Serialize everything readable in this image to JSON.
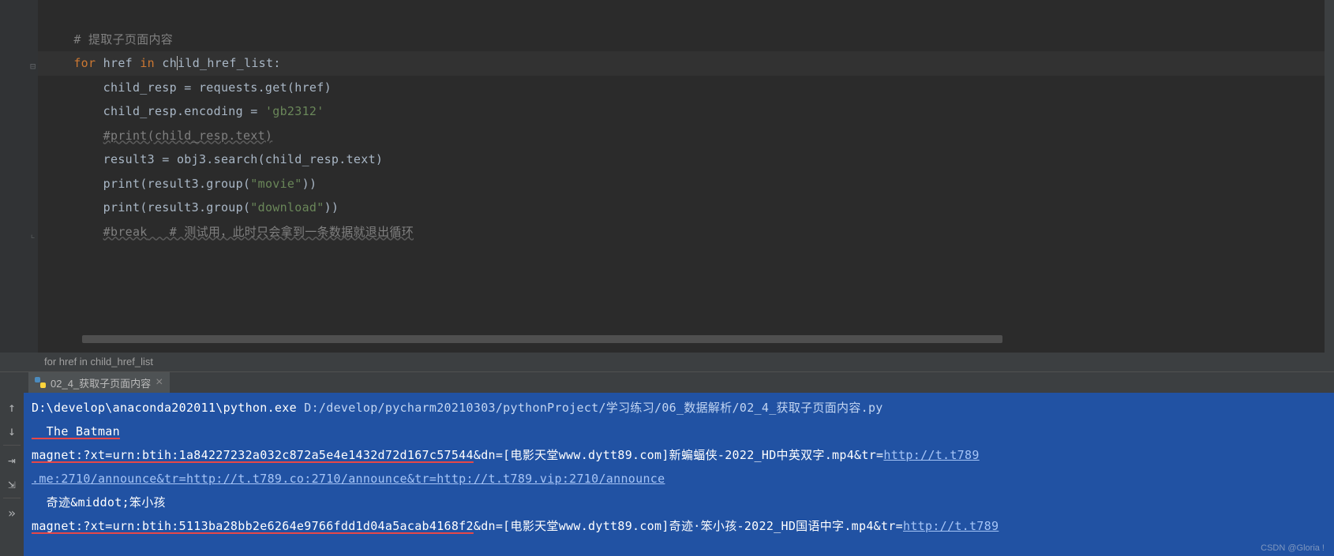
{
  "code": {
    "comment1": "# 提取子页面内容",
    "kw_for": "for",
    "var_href": "href",
    "kw_in": "in",
    "var_child_href_list": "child_href_list",
    "colon": ":",
    "line3_a": "child_resp = requests.get(href)",
    "line4_a": "child_resp.encoding = ",
    "line4_str": "'gb2312'",
    "line5": "#print(child_resp.text)",
    "line6": "result3 = obj3.search(child_resp.text)",
    "line7_a": "print",
    "line7_b": "(result3.group(",
    "line7_str": "\"movie\"",
    "line7_c": "))",
    "line8_a": "print",
    "line8_b": "(result3.group(",
    "line8_str": "\"download\"",
    "line8_c": "))",
    "line9_a": "#break",
    "line9_b": "   # 测试用，此时只会拿到一条数据就退出循环"
  },
  "breadcrumb": "for href in child_href_list",
  "tab": {
    "label": "02_4_获取子页面内容",
    "close": "×"
  },
  "console": {
    "line1_a": "D:\\develop\\anaconda202011\\python.exe ",
    "line1_b": "D:/develop/pycharm20210303/pythonProject/学习练习/06_数据解析/02_4_获取子页面内容.py",
    "line2": "  The Batman",
    "line3_a": "magnet:?xt=urn:btih:1a84227232a032c872a5e4e1432d72d167c57544",
    "line3_b": "&dn=[电影天堂www.dytt89.com]新蝙蝠侠-2022_HD中英双字.mp4&tr=",
    "line3_c": "http://t.t789",
    "line4_a": ".me:2710/announce&tr=http://t.t789.co:2710/announce&tr=http://t.t789.vip:2710/announce",
    "line5": "  奇迹&middot;笨小孩",
    "line6_a": "magnet:?xt=urn:btih:5113ba28bb2e6264e9766fdd1d04a5acab4168f2",
    "line6_b": "&dn=[电影天堂www.dytt89.com]奇迹·笨小孩-2022_HD国语中字.mp4&tr=",
    "line6_c": "http://t.t789"
  },
  "toolbar": {
    "up": "↑",
    "down": "↓",
    "wrap": "⇥",
    "stop": "⇲",
    "more": "»"
  },
  "watermark": "CSDN @Gloria !"
}
